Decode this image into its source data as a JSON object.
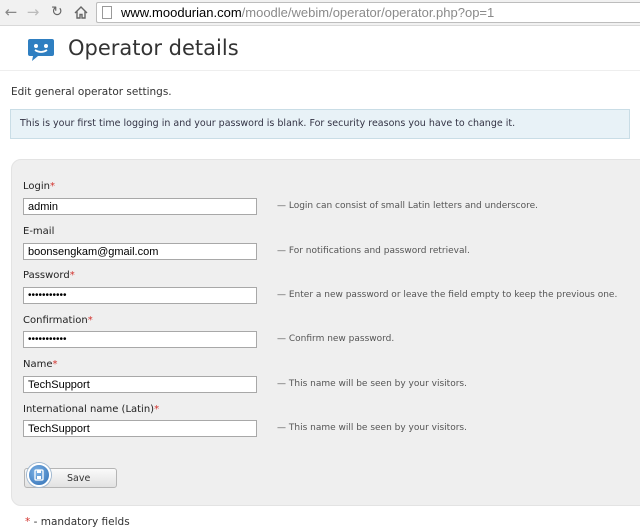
{
  "browser": {
    "url_domain": "www.moodurian.com",
    "url_path": "/moodle/webim/operator/operator.php?op=1"
  },
  "header": {
    "title": "Operator details",
    "logo_icon": "chat-bubble-icon"
  },
  "intro": "Edit general operator settings.",
  "notice": "This is your first time logging in and your password is blank. For security reasons you have to change it.",
  "form": {
    "fields": [
      {
        "label": "Login",
        "required": "*",
        "value": "admin",
        "hint": "— Login can consist of small Latin letters and underscore."
      },
      {
        "label": "E-mail",
        "required": "",
        "value": "boonsengkam@gmail.com",
        "hint": "— For notifications and password retrieval."
      },
      {
        "label": "Password",
        "required": "*",
        "value": "•••••••••••",
        "hint": "— Enter a new password or leave the field empty to keep the previous one."
      },
      {
        "label": "Confirmation",
        "required": "*",
        "value": "•••••••••••",
        "hint": "— Confirm new password."
      },
      {
        "label": "Name",
        "required": "*",
        "value": "TechSupport",
        "hint": "— This name will be seen by your visitors."
      },
      {
        "label": "International name (Latin)",
        "required": "*",
        "value": "TechSupport",
        "hint": "— This name will be seen by your visitors."
      }
    ],
    "save_label": "Save",
    "save_icon": "save-disk-icon"
  },
  "footnote": {
    "star": "*",
    "text": " - mandatory fields"
  },
  "colors": {
    "required": "#d2322d",
    "notice_bg": "#e8f2f7",
    "panel_bg": "#efefef",
    "logo_blue": "#2f7fc1"
  }
}
